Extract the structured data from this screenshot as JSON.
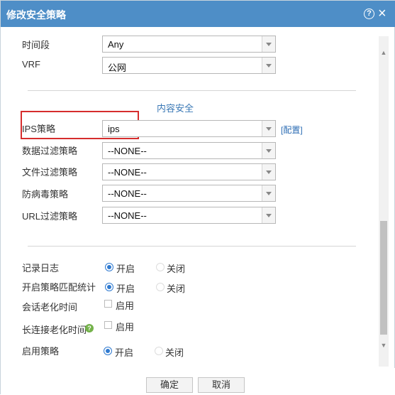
{
  "dialog": {
    "title": "修改安全策略",
    "help_icon_text": "?",
    "close_icon_text": "×"
  },
  "fields": {
    "time_period": {
      "label": "时间段",
      "value": "Any"
    },
    "vrf": {
      "label": "VRF",
      "value": "公网"
    }
  },
  "content_security": {
    "section_title": "内容安全",
    "config_link": "[配置]",
    "ips": {
      "label": "IPS策略",
      "value": "ips"
    },
    "data_filter": {
      "label": "数据过滤策略",
      "value": "--NONE--"
    },
    "file_filter": {
      "label": "文件过滤策略",
      "value": "--NONE--"
    },
    "antivirus": {
      "label": "防病毒策略",
      "value": "--NONE--"
    },
    "url_filter": {
      "label": "URL过滤策略",
      "value": "--NONE--"
    }
  },
  "options": {
    "record_log": {
      "label": "记录日志",
      "on": "开启",
      "off": "关闭",
      "selected": "on"
    },
    "policy_match_stats": {
      "label": "开启策略匹配统计",
      "on": "开启",
      "off": "关闭",
      "selected": "on"
    },
    "session_aging": {
      "label": "会话老化时间",
      "checkbox_label": "启用",
      "checked": false
    },
    "long_conn_aging": {
      "label": "长连接老化时间",
      "checkbox_label": "启用",
      "checked": false,
      "help_icon": "?"
    },
    "enable_policy": {
      "label": "启用策略",
      "on": "开启",
      "off": "关闭",
      "selected": "on"
    }
  },
  "footer": {
    "ok_label": "确定",
    "cancel_label": "取消"
  },
  "colors": {
    "titlebar": "#4e8ec7",
    "accent": "#2f7ad0",
    "highlight": "#d62d2d"
  }
}
